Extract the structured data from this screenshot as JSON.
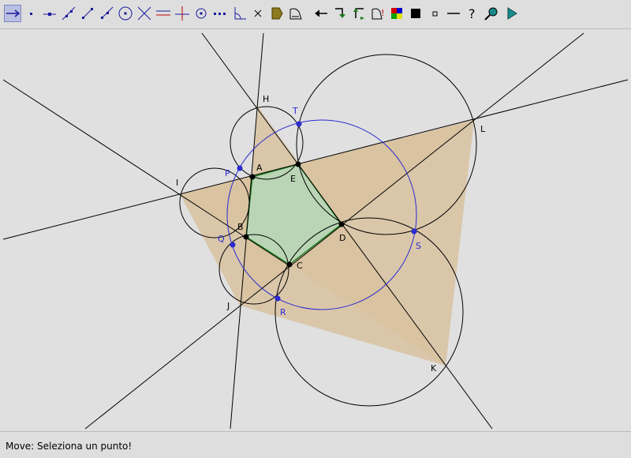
{
  "toolbar": {
    "tools": [
      {
        "name": "move-tool",
        "icon": "move-arrow-icon",
        "selected": true
      },
      {
        "name": "point-tool",
        "icon": "point-icon"
      },
      {
        "name": "point-on-object-tool",
        "icon": "point-on-line-icon"
      },
      {
        "name": "line-tool",
        "icon": "line-icon"
      },
      {
        "name": "segment-tool",
        "icon": "segment-icon"
      },
      {
        "name": "ray-tool",
        "icon": "ray-icon"
      },
      {
        "name": "circle-tool",
        "icon": "circle-center-icon"
      },
      {
        "name": "intersect-tool",
        "icon": "intersect-icon"
      },
      {
        "name": "parallel-tool",
        "icon": "parallel-icon"
      },
      {
        "name": "perpendicular-tool",
        "icon": "perpendicular-icon"
      },
      {
        "name": "midpoint-tool",
        "icon": "midpoint-icon"
      },
      {
        "name": "locus-tool",
        "icon": "dotted-line-icon"
      },
      {
        "name": "angle-tool",
        "icon": "angle-icon"
      },
      {
        "name": "delete-tool",
        "icon": "delete-x-icon"
      },
      {
        "name": "polygon-tool",
        "icon": "polygon-icon"
      },
      {
        "name": "measure-tool",
        "icon": "measure-icon"
      },
      {
        "name": "undo-tool",
        "icon": "back-arrow-icon"
      },
      {
        "name": "macro-tool",
        "icon": "macro-arrow-icon"
      },
      {
        "name": "redo-tool",
        "icon": "redo-arrow-icon"
      },
      {
        "name": "check-tool",
        "icon": "check-icon"
      },
      {
        "name": "color-tool",
        "icon": "color-palette-icon"
      },
      {
        "name": "fill-tool",
        "icon": "filled-square-icon"
      },
      {
        "name": "point-style-tool",
        "icon": "small-square-icon"
      },
      {
        "name": "line-style-tool",
        "icon": "line-thick-icon"
      },
      {
        "name": "help-tool",
        "icon": "question-icon"
      },
      {
        "name": "zoom-tool",
        "icon": "magnifier-icon"
      },
      {
        "name": "run-tool",
        "icon": "play-icon"
      }
    ]
  },
  "canvas": {
    "points": {
      "A": "A",
      "B": "B",
      "C": "C",
      "D": "D",
      "E": "E",
      "H": "H",
      "I": "I",
      "J": "J",
      "K": "K",
      "L": "L",
      "P": "P",
      "Q": "Q",
      "R": "R",
      "S": "S",
      "T": "T"
    },
    "colors": {
      "background": "#e0e0e0",
      "star_fill": "#d8c2a0",
      "pentagon_fill": "#b9d5b5",
      "pentagon_stroke": "#1e7a1e",
      "circle_blue": "#2a2ad0",
      "line": "#000000"
    }
  },
  "status": {
    "text": "Move: Seleziona un punto!"
  }
}
